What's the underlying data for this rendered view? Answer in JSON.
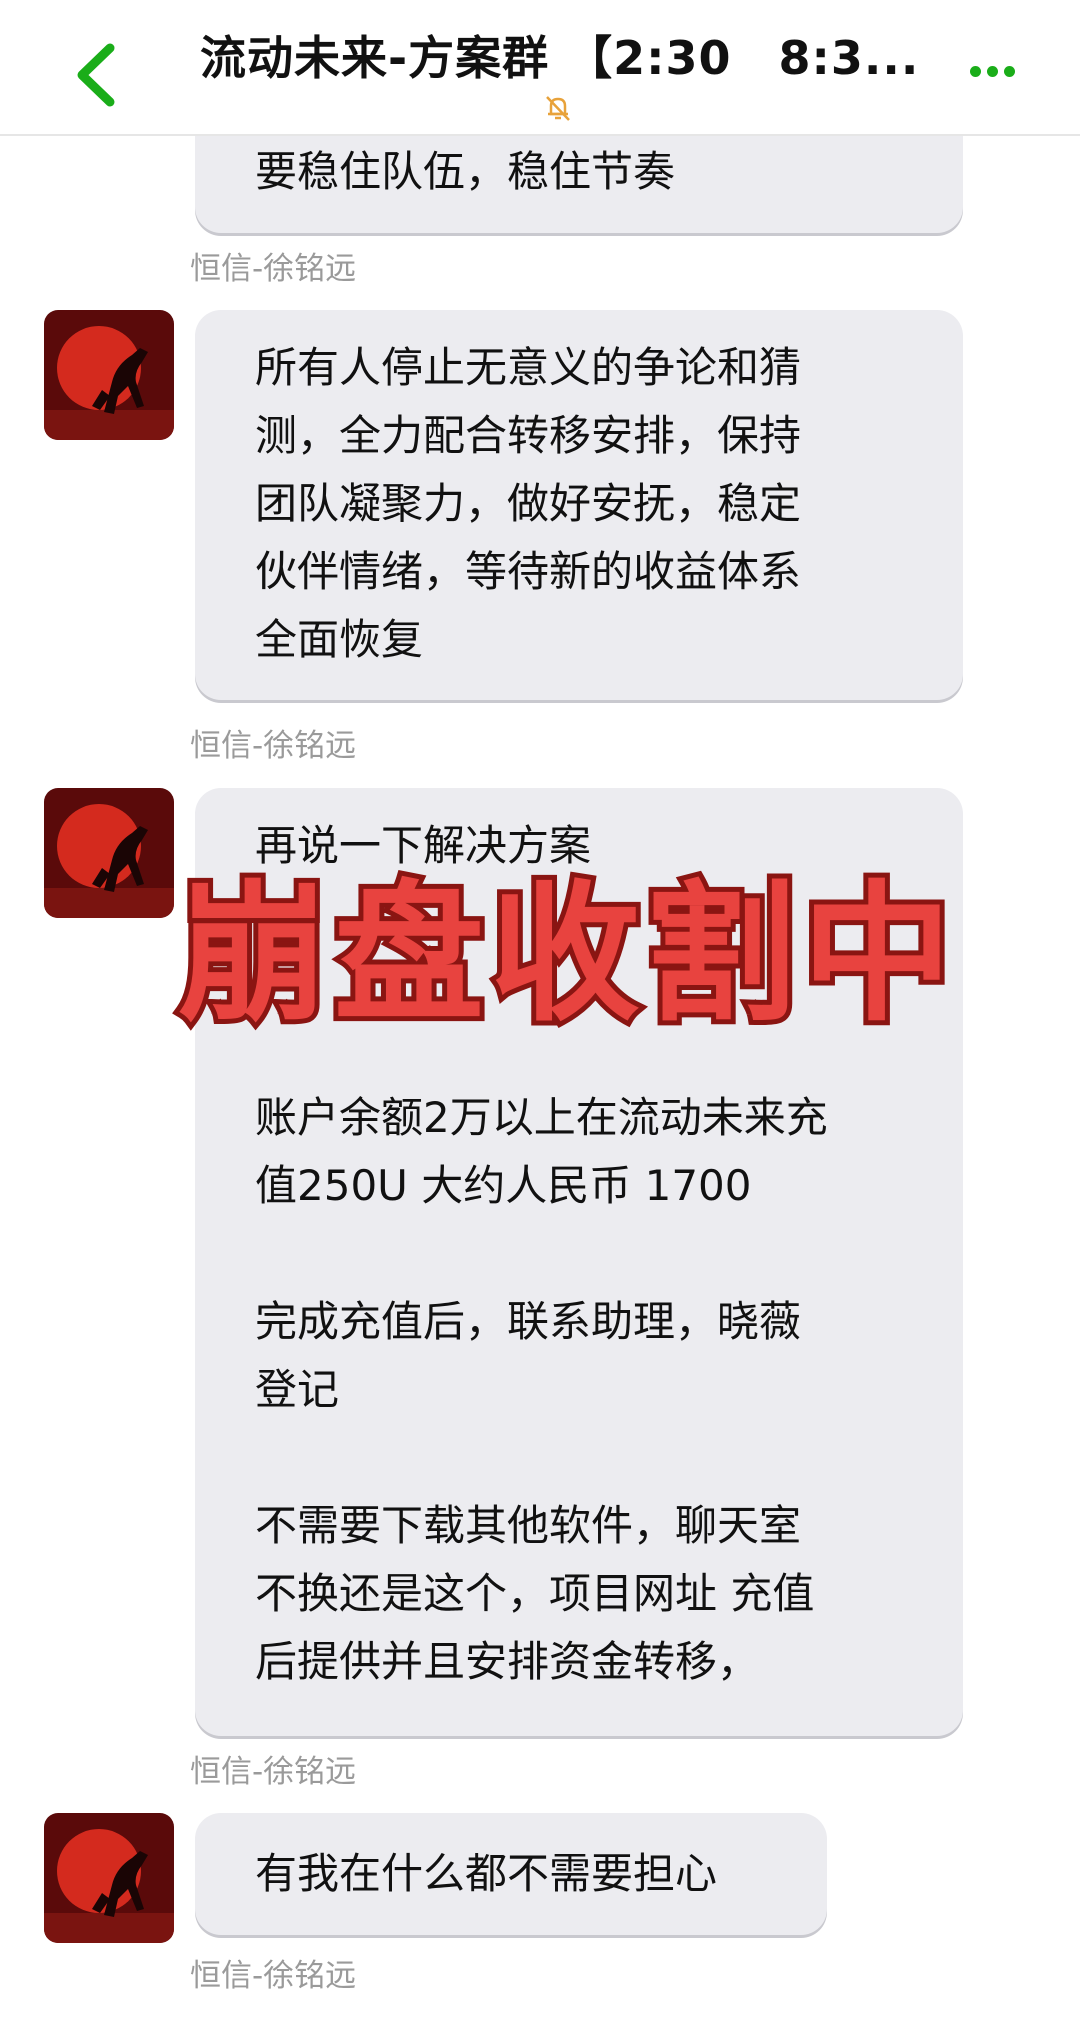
{
  "header": {
    "title": "流动未来-方案群 【2:30　8:3..."
  },
  "messages": [
    {
      "text": "要稳住队伍，稳住节奏",
      "sender": "恒信-徐铭远"
    },
    {
      "text": "所有人停止无意义的争论和猜\n测，全力配合转移安排，保持\n团队凝聚力，做好安抚，稳定\n伙伴情绪，等待新的收益体系\n全面恢复",
      "sender": "恒信-徐铭远"
    },
    {
      "text": "再说一下解决方案\n\n\n\n账户余额2万以上在流动未来充\n值250U 大约人民币 1700\n\n完成充值后，联系助理，晓薇\n登记\n\n不需要下载其他软件，聊天室\n不换还是这个，项目网址 充值\n后提供并且安排资金转移，",
      "sender": "恒信-徐铭远"
    },
    {
      "text": "有我在什么都不需要担心",
      "sender": "恒信-徐铭远"
    }
  ],
  "overlay": {
    "text": "崩盘收割中"
  },
  "colors": {
    "accent": "#1aad19",
    "overlay": "#e8433f"
  },
  "icons": {
    "back": "chevron-left-icon",
    "mute": "bell-off-icon",
    "more": "more-dots-icon",
    "avatar": "horse-avatar"
  }
}
